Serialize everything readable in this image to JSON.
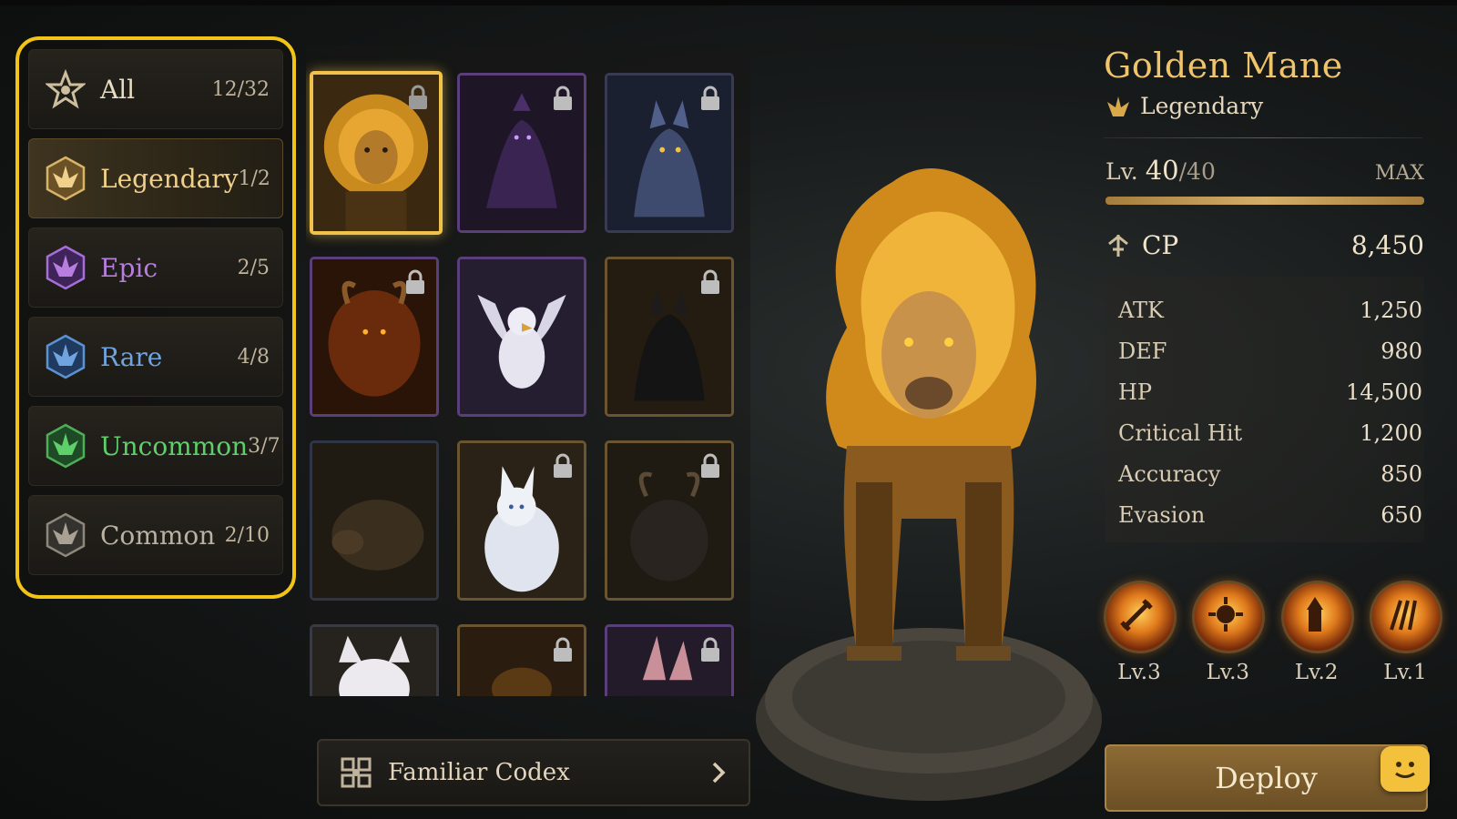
{
  "categories": [
    {
      "label": "All",
      "count": "12/32",
      "color": "#e8dcc2",
      "icon": "star-emblem-icon"
    },
    {
      "label": "Legendary",
      "count": "1/2",
      "color": "#f0d08a",
      "icon": "legendary-crest-icon"
    },
    {
      "label": "Epic",
      "count": "2/5",
      "color": "#b77ee0",
      "icon": "epic-crest-icon"
    },
    {
      "label": "Rare",
      "count": "4/8",
      "color": "#6fa4e0",
      "icon": "rare-crest-icon"
    },
    {
      "label": "Uncommon",
      "count": "3/7",
      "color": "#5fcf6a",
      "icon": "uncommon-crest-icon"
    },
    {
      "label": "Common",
      "count": "2/10",
      "color": "#b9b2a4",
      "icon": "common-crest-icon"
    }
  ],
  "familiars": [
    {
      "name": "golden-lion",
      "locked": true,
      "selected": true
    },
    {
      "name": "shadow-dragon",
      "locked": true
    },
    {
      "name": "frost-wolf",
      "locked": true
    },
    {
      "name": "fire-demon",
      "locked": true
    },
    {
      "name": "white-griffin",
      "locked": false
    },
    {
      "name": "black-wolf",
      "locked": true
    },
    {
      "name": "boar",
      "locked": false
    },
    {
      "name": "white-fox",
      "locked": true
    },
    {
      "name": "horned-beast",
      "locked": true
    },
    {
      "name": "white-cat",
      "locked": false
    },
    {
      "name": "ember-beast",
      "locked": true
    },
    {
      "name": "crystal-beast",
      "locked": true
    }
  ],
  "codex": {
    "label": "Familiar Codex",
    "icon": "codex-icon"
  },
  "details": {
    "name": "Golden Mane",
    "rarity": "Legendary",
    "level_prefix": "Lv.",
    "level_current": "40",
    "level_max": "/40",
    "level_tag": "MAX",
    "level_fraction": 1.0,
    "cp_label": "CP",
    "cp_value": "8,450",
    "stats": [
      {
        "label": "ATK",
        "value": "1,250"
      },
      {
        "label": "DEF",
        "value": "980"
      },
      {
        "label": "HP",
        "value": "14,500"
      },
      {
        "label": "Critical Hit",
        "value": "1,200"
      },
      {
        "label": "Accuracy",
        "value": "850"
      },
      {
        "label": "Evasion",
        "value": "650"
      }
    ],
    "skills": [
      {
        "level": "Lv.3",
        "icon": "sword-skill-icon"
      },
      {
        "level": "Lv.3",
        "icon": "flame-burst-skill-icon"
      },
      {
        "level": "Lv.2",
        "icon": "rising-fist-skill-icon"
      },
      {
        "level": "Lv.1",
        "icon": "claw-skill-icon"
      }
    ],
    "deploy_label": "Deploy"
  },
  "colors": {
    "highlight": "#f2c418",
    "gold": "#f0c46b",
    "epic": "#b77ee0",
    "rare": "#6fa4e0",
    "uncommon": "#5fcf6a"
  }
}
